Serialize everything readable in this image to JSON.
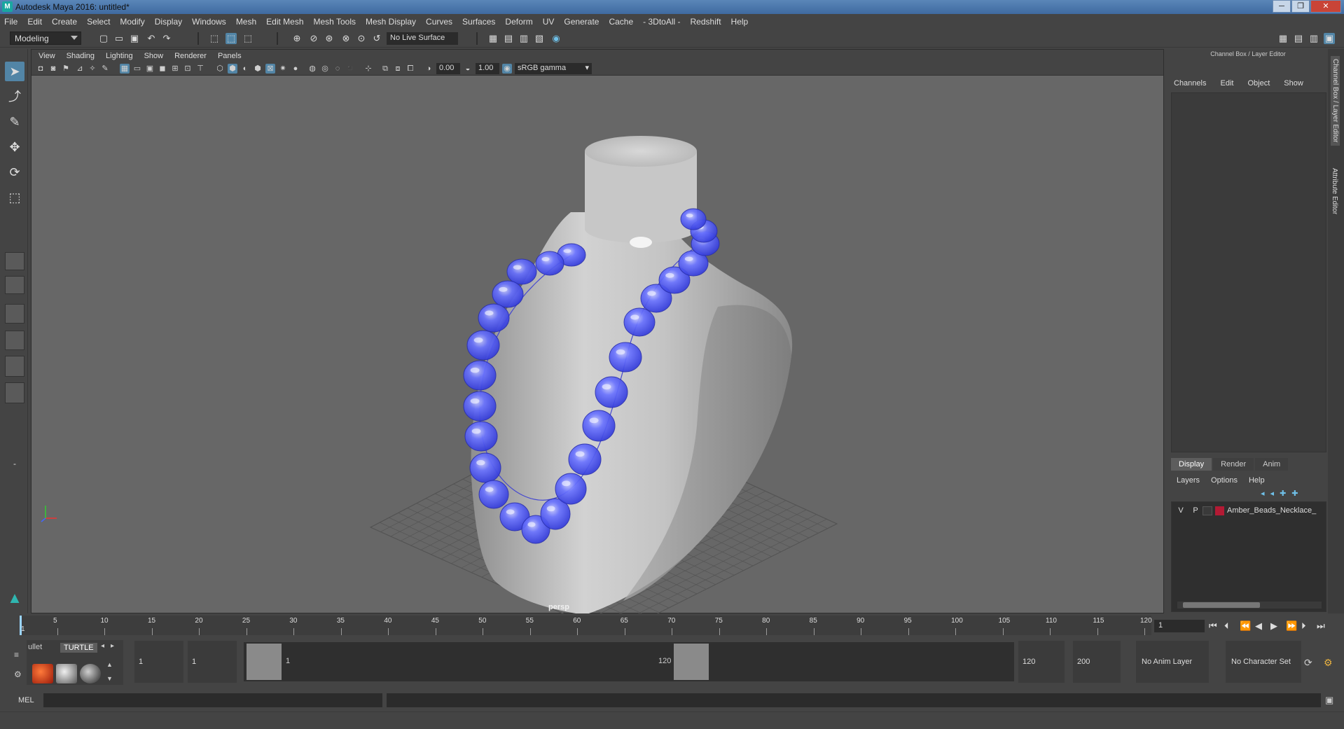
{
  "app": {
    "title": "Autodesk Maya 2016: untitled*",
    "icon_label": "M"
  },
  "window_buttons": [
    "─",
    "❐",
    "✕"
  ],
  "menubar": [
    "File",
    "Edit",
    "Create",
    "Select",
    "Modify",
    "Display",
    "Windows",
    "Mesh",
    "Edit Mesh",
    "Mesh Tools",
    "Mesh Display",
    "Curves",
    "Surfaces",
    "Deform",
    "UV",
    "Generate",
    "Cache",
    "- 3DtoAll -",
    "Redshift",
    "Help"
  ],
  "status_line": {
    "mode": "Modeling",
    "live_surface": "No Live Surface"
  },
  "viewport": {
    "menu": [
      "View",
      "Shading",
      "Lighting",
      "Show",
      "Renderer",
      "Panels"
    ],
    "exposure": "0.00",
    "gamma": "1.00",
    "color_space": "sRGB gamma",
    "camera": "persp"
  },
  "channel_box": {
    "title": "Channel Box / Layer Editor",
    "menu": [
      "Channels",
      "Edit",
      "Object",
      "Show"
    ]
  },
  "layer_editor": {
    "tabs": [
      "Display",
      "Render",
      "Anim"
    ],
    "active_tab": "Display",
    "menu": [
      "Layers",
      "Options",
      "Help"
    ],
    "layers": [
      {
        "v": "V",
        "p": "P",
        "color": "#b31a34",
        "name": "Amber_Beads_Necklace_"
      }
    ]
  },
  "side_tabs": [
    "Channel Box / Layer Editor",
    "Attribute Editor"
  ],
  "timeline": {
    "ticks": [
      "5",
      "10",
      "15",
      "20",
      "25",
      "30",
      "35",
      "40",
      "45",
      "50",
      "55",
      "60",
      "65",
      "70",
      "75",
      "80",
      "85",
      "90",
      "95",
      "100",
      "105",
      "110",
      "115",
      "120"
    ],
    "current_marker": "1",
    "current_frame": "1",
    "playback_icons": [
      "⏮",
      "⏴",
      "⏪",
      "◀",
      "▶",
      "⏩",
      "⏵",
      "⏭"
    ]
  },
  "range": {
    "shelf_tabs": [
      "ullet",
      "TURTLE"
    ],
    "start_time": "1",
    "playback_start": "1",
    "range_start_label": "1",
    "range_end_label": "120",
    "playback_end": "120",
    "end_time": "200",
    "anim_layer": "No Anim Layer",
    "character_set": "No Character Set"
  },
  "command_line": {
    "label": "MEL"
  },
  "colors": {
    "accent": "#5285a6",
    "bead": "#4a55ff",
    "viewport_bg": "#676767"
  }
}
